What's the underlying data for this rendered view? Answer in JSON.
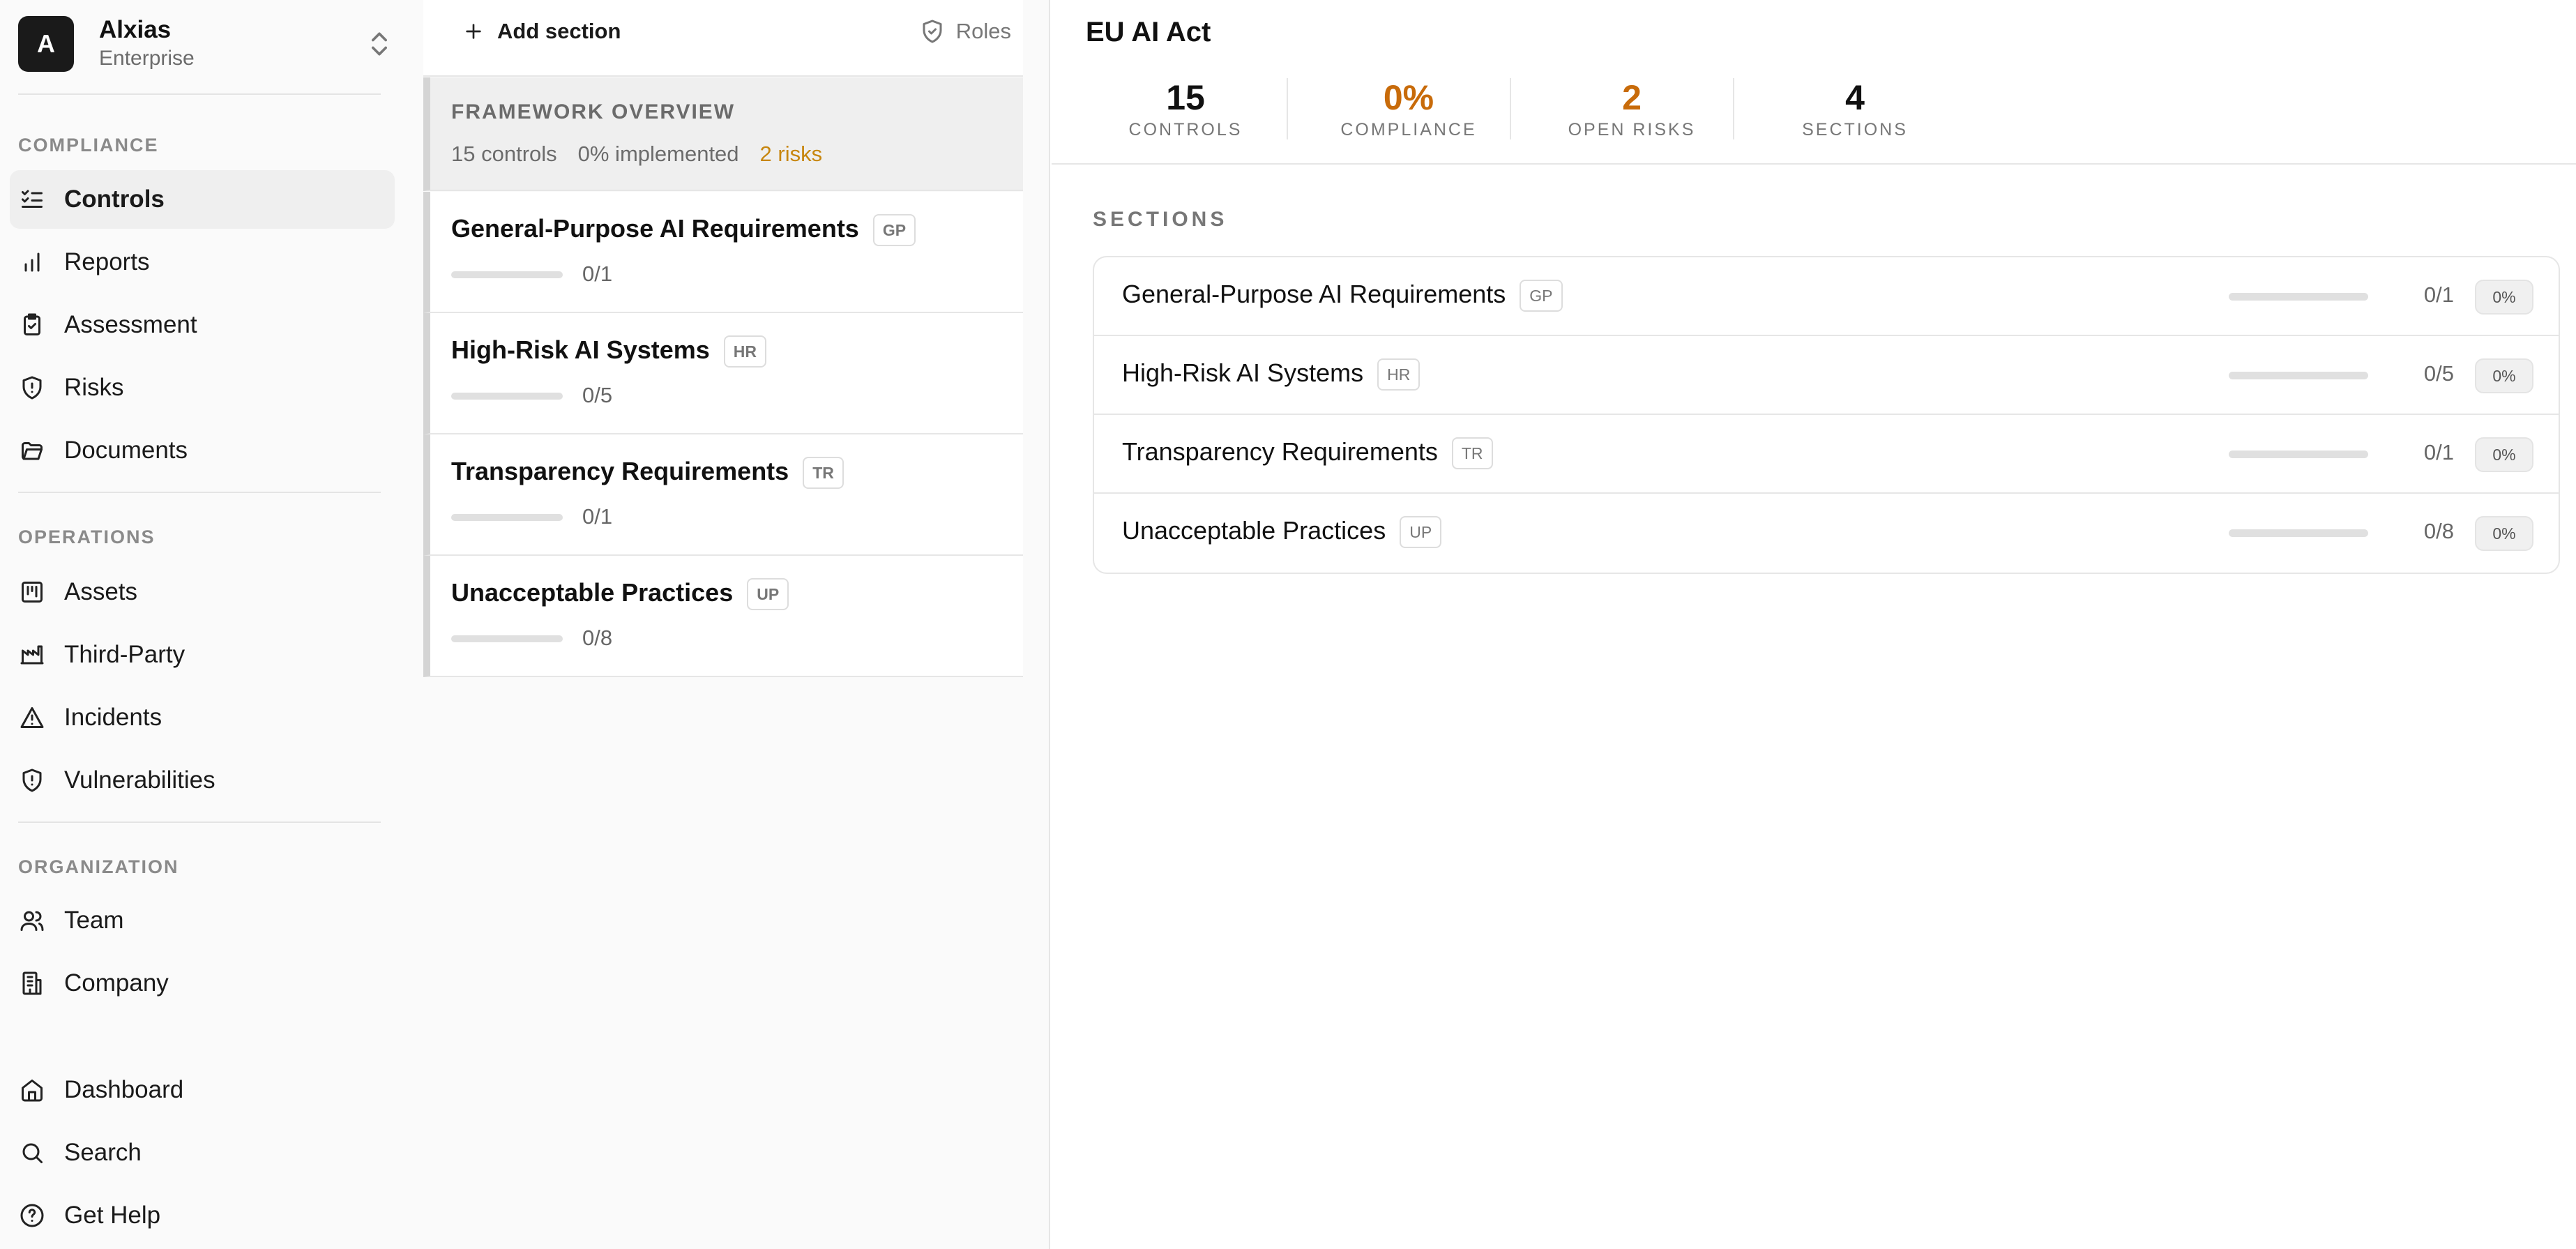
{
  "org": {
    "initial": "A",
    "name": "Alxias",
    "plan": "Enterprise"
  },
  "sidebar": {
    "groups": [
      {
        "label": "COMPLIANCE",
        "items": [
          "Controls",
          "Reports",
          "Assessment",
          "Risks",
          "Documents"
        ]
      },
      {
        "label": "OPERATIONS",
        "items": [
          "Assets",
          "Third-Party",
          "Incidents",
          "Vulnerabilities"
        ]
      },
      {
        "label": "ORGANIZATION",
        "items": [
          "Team",
          "Company"
        ]
      }
    ],
    "bottom_items": [
      "Dashboard",
      "Search",
      "Get Help"
    ],
    "active_item": "Controls"
  },
  "toolbar": {
    "add_section_label": "Add section",
    "roles_label": "Roles"
  },
  "framework_overview": {
    "title": "FRAMEWORK OVERVIEW",
    "controls": "15 controls",
    "implemented": "0% implemented",
    "risks": "2 risks"
  },
  "section_cards": [
    {
      "title": "General-Purpose AI Requirements",
      "badge": "GP",
      "count": "0/1",
      "progress": 0
    },
    {
      "title": "High-Risk AI Systems",
      "badge": "HR",
      "count": "0/5",
      "progress": 0
    },
    {
      "title": "Transparency Requirements",
      "badge": "TR",
      "count": "0/1",
      "progress": 0
    },
    {
      "title": "Unacceptable Practices",
      "badge": "UP",
      "count": "0/8",
      "progress": 0
    }
  ],
  "main": {
    "title": "EU AI Act",
    "stats": [
      {
        "value": "15",
        "label": "CONTROLS",
        "highlight": false
      },
      {
        "value": "0%",
        "label": "COMPLIANCE",
        "highlight": true
      },
      {
        "value": "2",
        "label": "OPEN RISKS",
        "highlight": true
      },
      {
        "value": "4",
        "label": "SECTIONS",
        "highlight": false
      }
    ],
    "sections_label": "SECTIONS",
    "sections": [
      {
        "name": "General-Purpose AI Requirements",
        "badge": "GP",
        "count": "0/1",
        "percent": "0%",
        "progress": 0
      },
      {
        "name": "High-Risk AI Systems",
        "badge": "HR",
        "count": "0/5",
        "percent": "0%",
        "progress": 0
      },
      {
        "name": "Transparency Requirements",
        "badge": "TR",
        "count": "0/1",
        "percent": "0%",
        "progress": 0
      },
      {
        "name": "Unacceptable Practices",
        "badge": "UP",
        "count": "0/8",
        "percent": "0%",
        "progress": 0
      }
    ]
  },
  "colors": {
    "accent_orange": "#c86b0a",
    "risk_orange": "#c7860e",
    "progress_fill": "#2e7d32",
    "active_bg": "#efefef"
  }
}
